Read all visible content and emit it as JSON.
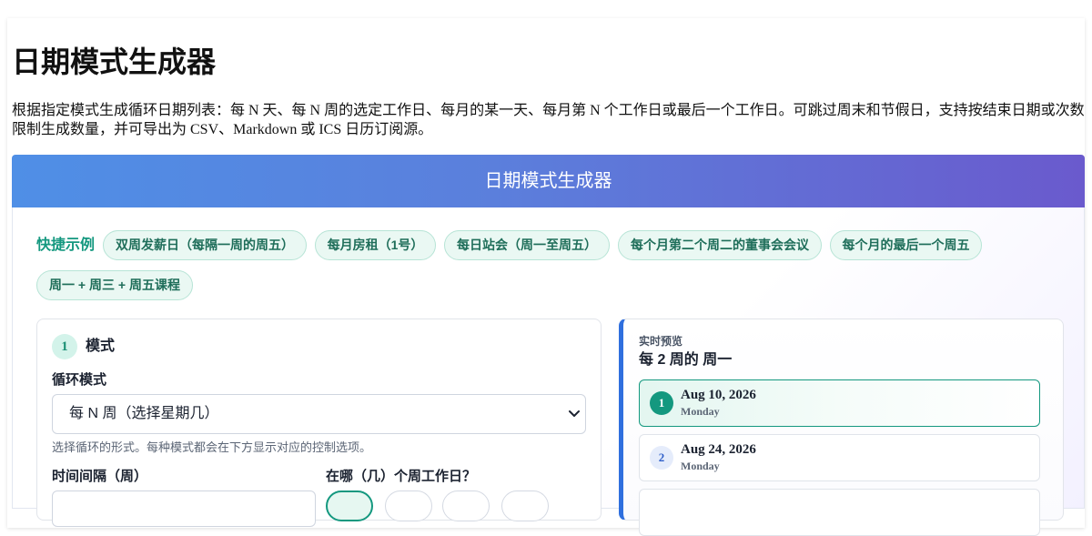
{
  "page": {
    "title": "日期模式生成器",
    "description": "根据指定模式生成循环日期列表：每 N 天、每 N 周的选定工作日、每月的某一天、每月第 N 个工作日或最后一个工作日。可跳过周末和节假日，支持按结束日期或次数限制生成数量，并可导出为 CSV、Markdown 或 ICS 日历订阅源。"
  },
  "app": {
    "header_title": "日期模式生成器",
    "quick_examples": {
      "label": "快捷示例",
      "items": [
        "双周发薪日（每隔一周的周五）",
        "每月房租（1号）",
        "每日站会（周一至周五）",
        "每个月第二个周二的董事会会议",
        "每个月的最后一个周五",
        "周一 + 周三 + 周五课程"
      ]
    },
    "mode_section": {
      "step_number": "1",
      "title": "模式",
      "repeat_mode_label": "循环模式",
      "repeat_mode_value": "每 N 周（选择星期几）",
      "repeat_mode_hint": "选择循环的形式。每种模式都会在下方显示对应的控制选项。",
      "interval_label": "时间间隔（周）",
      "weekdays_label": "在哪（几）个周工作日？"
    },
    "preview": {
      "label": "实时预览",
      "summary": "每 2 周的 周一",
      "dates": [
        {
          "index": "1",
          "date": "Aug 10, 2026",
          "weekday": "Monday"
        },
        {
          "index": "2",
          "date": "Aug 24, 2026",
          "weekday": "Monday"
        }
      ]
    }
  },
  "colors": {
    "accent": "#14987f",
    "banner_start": "#4f8fe6",
    "banner_end": "#6a5acd",
    "preview_border": "#2f6fde"
  },
  "icons": {
    "select_arrow": "chevron-down-icon"
  }
}
